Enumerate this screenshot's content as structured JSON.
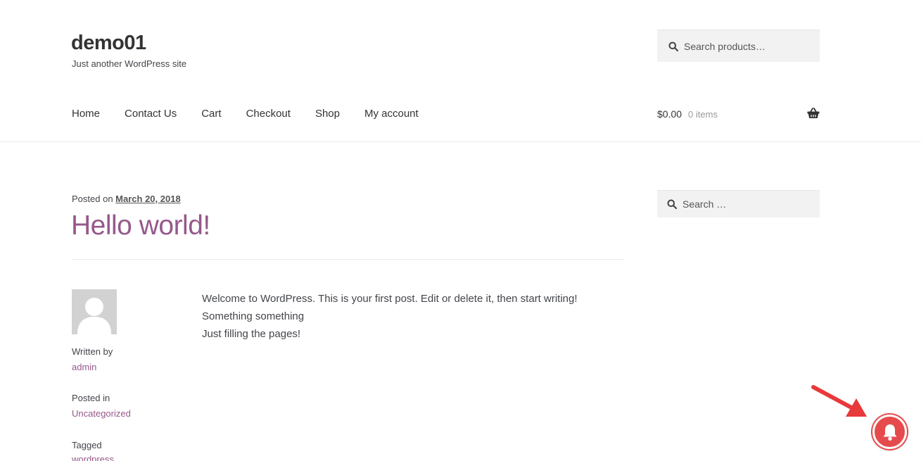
{
  "site": {
    "title": "demo01",
    "tagline": "Just another WordPress site"
  },
  "header": {
    "product_search_placeholder": "Search products…",
    "nav": [
      "Home",
      "Contact Us",
      "Cart",
      "Checkout",
      "Shop",
      "My account"
    ],
    "cart_amount": "$0.00",
    "cart_count": "0 items"
  },
  "post": {
    "posted_on_prefix": "Posted on",
    "date": "March 20, 2018",
    "title": "Hello world!",
    "written_by_label": "Written by",
    "author": "admin",
    "posted_in_label": "Posted in",
    "category": "Uncategorized",
    "tagged_label": "Tagged",
    "tag": "wordpress",
    "content": [
      "Welcome to WordPress. This is your first post. Edit or delete it, then start writing!",
      "Something something",
      "Just filling the pages!"
    ]
  },
  "sidebar": {
    "search_placeholder": "Search …"
  },
  "colors": {
    "accent": "#96588a",
    "bell": "#e54b4d",
    "arrow": "#e8393b"
  },
  "icons": {
    "search": "search-icon",
    "cart": "basket-icon",
    "bell": "bell-icon",
    "avatar": "avatar-icon",
    "arrow": "arrow-icon"
  }
}
